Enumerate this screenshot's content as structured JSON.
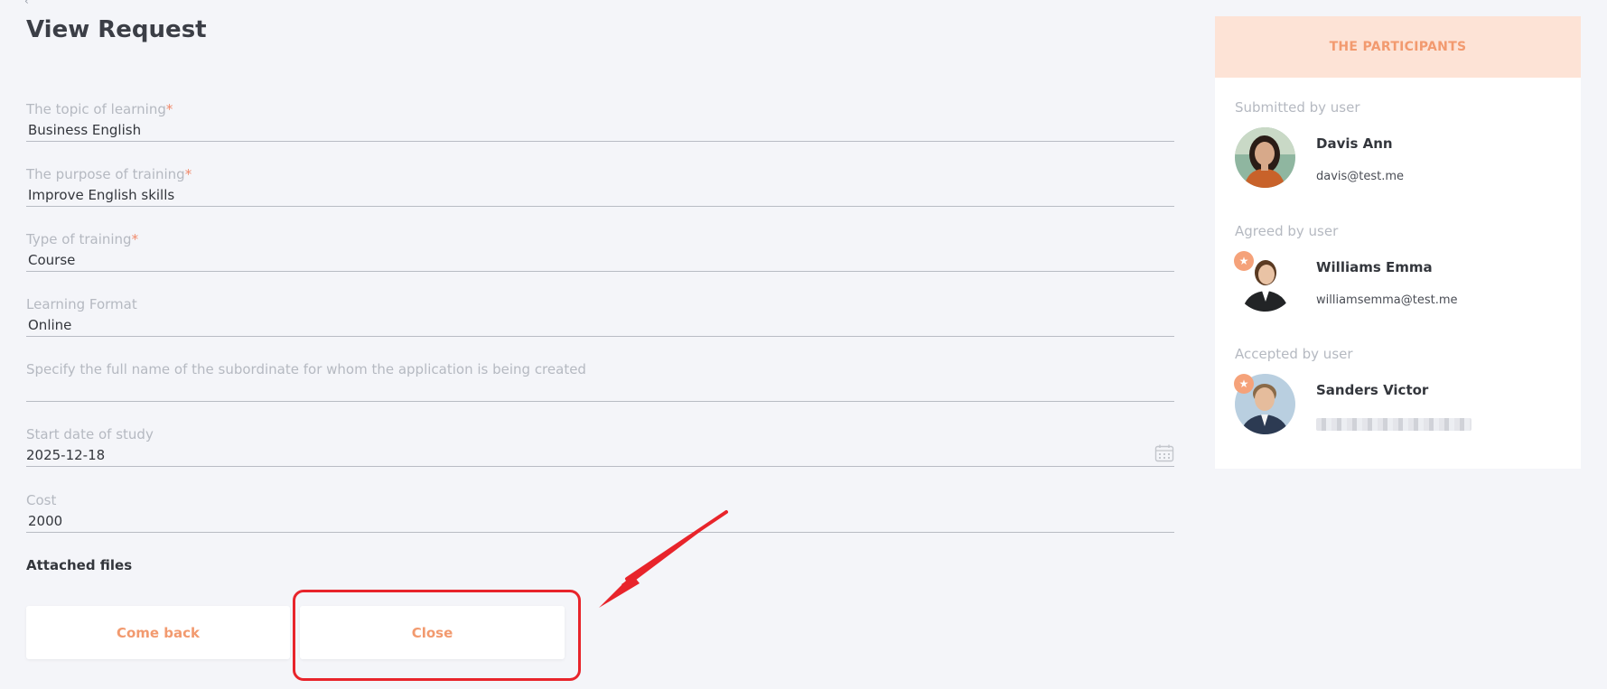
{
  "page": {
    "title": "View Request"
  },
  "form": {
    "fields": [
      {
        "label": "The topic of learning",
        "required": "*",
        "value": "Business English"
      },
      {
        "label": "The purpose of training",
        "required": "*",
        "value": " Improve English skills"
      },
      {
        "label": "Type of training",
        "required": "*",
        "value": "Course"
      },
      {
        "label": "Learning Format",
        "required": "",
        "value": "Online"
      },
      {
        "label": "Specify the full name of the subordinate for whom the application is being created",
        "required": "",
        "value": ""
      },
      {
        "label": "Start date of study",
        "required": "",
        "value": "2025-12-18"
      },
      {
        "label": "Cost",
        "required": "",
        "value": "2000"
      }
    ],
    "attached_files_label": "Attached files"
  },
  "buttons": {
    "come_back": "Come back",
    "close": "Close"
  },
  "participants": {
    "header": "THE PARTICIPANTS",
    "list": [
      {
        "role": "Submitted by user",
        "name": "Davis Ann",
        "email": "davis@test.me",
        "starred": false
      },
      {
        "role": "Agreed by user",
        "name": "Williams Emma",
        "email": "williamsemma@test.me",
        "starred": true
      },
      {
        "role": "Accepted by user",
        "name": "Sanders Victor",
        "email": "",
        "starred": true
      }
    ]
  },
  "colors": {
    "accent": "#f29a6f",
    "header_bg": "#fde3d6",
    "required": "#f08a6b",
    "annotation": "#e8242b"
  },
  "icons": {
    "calendar": "calendar-icon",
    "star": "star-icon",
    "back": "chevron-left-icon"
  }
}
